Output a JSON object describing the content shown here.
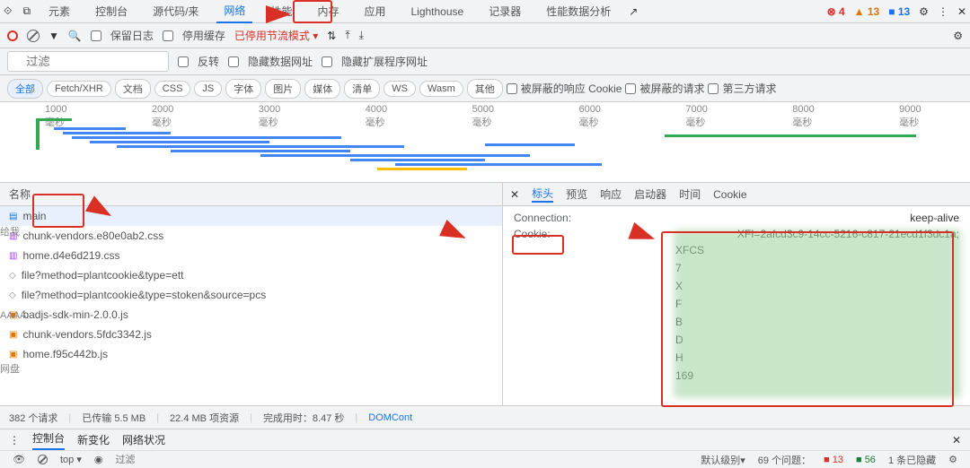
{
  "tabs": [
    "元素",
    "控制台",
    "源代码/来",
    "网络",
    "性能",
    "内存",
    "应用",
    "Lighthouse",
    "记录器",
    "性能数据分析"
  ],
  "active_tab": 3,
  "status": {
    "errors": 4,
    "warnings": 13,
    "info": 13
  },
  "toolbar": {
    "preserve_log": "保留日志",
    "disable_cache": "停用缓存",
    "throttle": "已停用节流模式"
  },
  "filter": {
    "placeholder": "过滤",
    "invert": "反转",
    "hide_data_urls": "隐藏数据网址",
    "hide_ext_urls": "隐藏扩展程序网址"
  },
  "chips": [
    "全部",
    "Fetch/XHR",
    "文档",
    "CSS",
    "JS",
    "字体",
    "图片",
    "媒体",
    "清单",
    "WS",
    "Wasm",
    "其他"
  ],
  "active_chip": 0,
  "chip_checks": {
    "blocked_cookies": "被屏蔽的响应 Cookie",
    "blocked_req": "被屏蔽的请求",
    "third_party": "第三方请求"
  },
  "time_labels": [
    "1000 毫秒",
    "2000 毫秒",
    "3000 毫秒",
    "4000 毫秒",
    "5000 毫秒",
    "6000 毫秒",
    "7000 毫秒",
    "8000 毫秒",
    "9000 毫秒"
  ],
  "name_header": "名称",
  "requests": [
    {
      "name": "main",
      "type": "doc",
      "selected": true
    },
    {
      "name": "chunk-vendors.e80e0ab2.css",
      "type": "css"
    },
    {
      "name": "home.d4e6d219.css",
      "type": "css"
    },
    {
      "name": "file?method=plantcookie&type=ett",
      "type": "xhr"
    },
    {
      "name": "file?method=plantcookie&type=stoken&source=pcs",
      "type": "xhr"
    },
    {
      "name": "badjs-sdk-min-2.0.0.js",
      "type": "js"
    },
    {
      "name": "chunk-vendors.5fdc3342.js",
      "type": "js"
    },
    {
      "name": "home.f95c442b.js",
      "type": "js"
    }
  ],
  "detail_tabs": [
    "标头",
    "预览",
    "响应",
    "启动器",
    "时间",
    "Cookie"
  ],
  "active_detail_tab": 0,
  "headers": {
    "connection_k": "Connection:",
    "connection_v": "keep-alive",
    "cookie_k": "Cookie:",
    "cookie_v": "XFI=2afcd3c9-14cc-5216-c817-21ecd1f3dc1a;",
    "partial": [
      "XFCS",
      "7",
      "X",
      "F",
      "B",
      "D",
      "H",
      "169"
    ]
  },
  "footer": {
    "reqs": "382 个请求",
    "transferred": "已传输 5.5 MB",
    "resources": "22.4 MB 项资源",
    "finish": "完成用时：8.47 秒",
    "dom": "DOMCont"
  },
  "console_tabs": [
    "控制台",
    "新变化",
    "网络状况"
  ],
  "console_footer": {
    "top": "top ▾",
    "filter_placeholder": "过滤",
    "level": "默认级别▾",
    "issues": "69 个问题：",
    "i1": "13",
    "i2": "56",
    "hidden": "1 条已隐藏"
  },
  "side": {
    "a": "给我",
    "b": "AAAA",
    "c": "网盘"
  }
}
